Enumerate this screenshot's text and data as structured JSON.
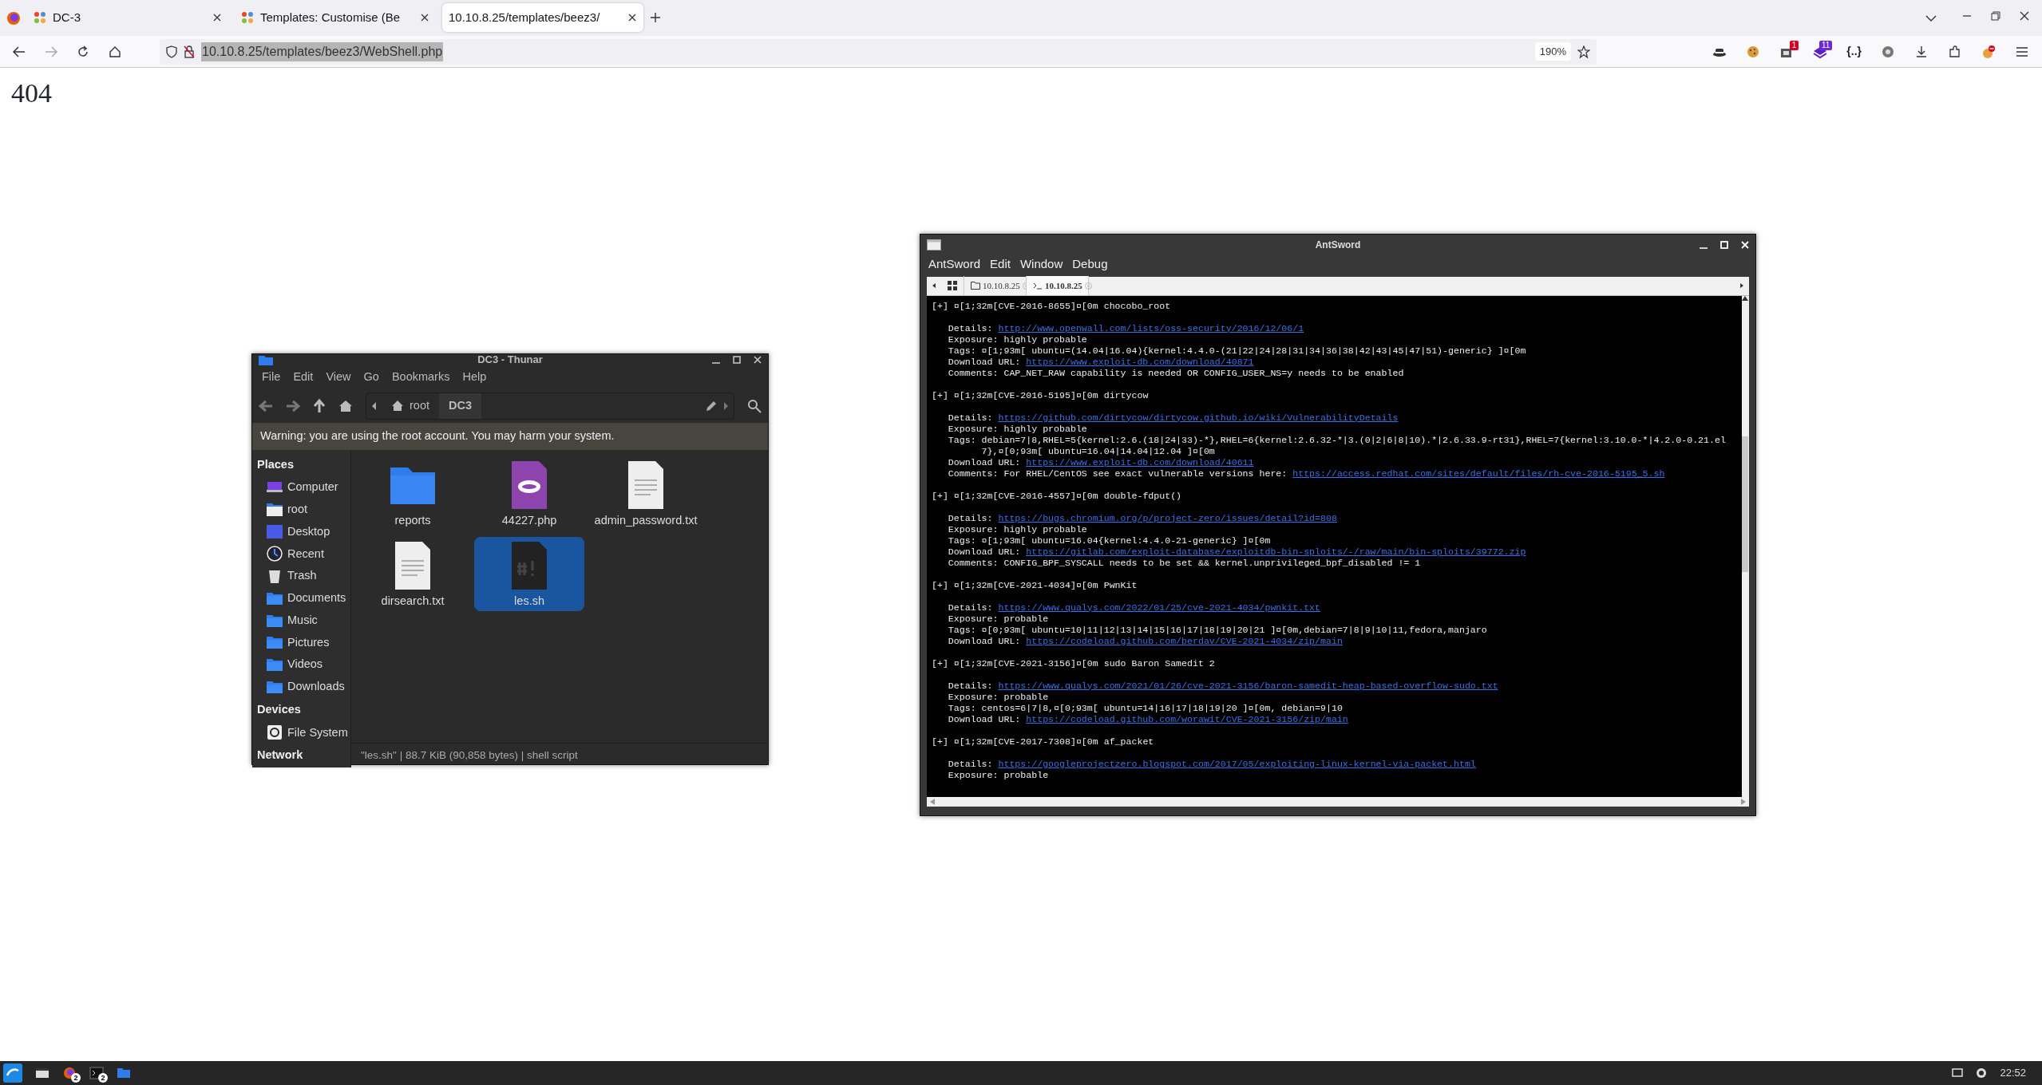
{
  "browser": {
    "tabs": [
      {
        "label": "DC-3",
        "kind": "joomla",
        "selected": false
      },
      {
        "label": "Templates: Customise (Be",
        "kind": "joomla",
        "selected": false
      },
      {
        "label": "10.10.8.25/templates/beez3/",
        "kind": "plain",
        "selected": true
      }
    ],
    "url": "10.10.8.25/templates/beez3/WebShell.php",
    "zoom": "190%",
    "extensions": [
      {
        "kind": "hat"
      },
      {
        "kind": "cookie"
      },
      {
        "kind": "mail",
        "badge": "1"
      },
      {
        "kind": "stack",
        "badge": "11"
      },
      {
        "kind": "braces",
        "label": "{..}"
      },
      {
        "kind": "gear"
      },
      {
        "kind": "download"
      },
      {
        "kind": "puzzle"
      },
      {
        "kind": "blocker"
      },
      {
        "kind": "menu"
      }
    ]
  },
  "page": {
    "heading": "404"
  },
  "thunar": {
    "title": "DC3 - Thunar",
    "menu": [
      "File",
      "Edit",
      "View",
      "Go",
      "Bookmarks",
      "Help"
    ],
    "path": [
      {
        "label": "root",
        "kind": "home",
        "selected": false
      },
      {
        "label": "DC3",
        "kind": "plain",
        "selected": true
      }
    ],
    "warning": "Warning: you are using the root account. You may harm your system.",
    "sidebar": [
      {
        "heading": "Places",
        "items": [
          {
            "label": "Computer",
            "kind": "computer"
          },
          {
            "label": "root",
            "kind": "home"
          },
          {
            "label": "Desktop",
            "kind": "desktop"
          },
          {
            "label": "Recent",
            "kind": "clock"
          },
          {
            "label": "Trash",
            "kind": "trash"
          },
          {
            "label": "Documents",
            "kind": "folder"
          },
          {
            "label": "Music",
            "kind": "folder"
          },
          {
            "label": "Pictures",
            "kind": "folder"
          },
          {
            "label": "Videos",
            "kind": "folder"
          },
          {
            "label": "Downloads",
            "kind": "folder"
          }
        ]
      },
      {
        "heading": "Devices",
        "items": [
          {
            "label": "File System",
            "kind": "drive"
          }
        ]
      },
      {
        "heading": "Network"
      }
    ],
    "files": [
      {
        "name": "reports",
        "kind": "folder",
        "selected": false
      },
      {
        "name": "44227.php",
        "kind": "php",
        "selected": false
      },
      {
        "name": "admin_password.txt",
        "kind": "text",
        "selected": false
      },
      {
        "name": "dirsearch.txt",
        "kind": "text",
        "selected": false
      },
      {
        "name": "les.sh",
        "kind": "script",
        "selected": true
      }
    ],
    "status": "\"les.sh\"  |  88.7 KiB (90,858 bytes)  |  shell script"
  },
  "antsword": {
    "title": "AntSword",
    "menu": [
      "AntSword",
      "Edit",
      "Window",
      "Debug"
    ],
    "tabs": [
      {
        "label": "10.10.8.25",
        "kind": "folder",
        "selected": false
      },
      {
        "label": "10.10.8.25",
        "kind": "terminal",
        "selected": true
      }
    ],
    "entries": [
      {
        "header": "[+] ¤[1;32m[CVE-2016-8655]¤[0m chocobo_root",
        "fields": [
          {
            "label": "Details:",
            "link": "http://www.openwall.com/lists/oss-security/2016/12/06/1"
          },
          {
            "label": "Exposure:",
            "value": "highly probable"
          },
          {
            "label": "Tags:",
            "value": "¤[1;93m[ ubuntu=(14.04|16.04){kernel:4.4.0-(21|22|24|28|31|34|36|38|42|43|45|47|51)-generic} ]¤[0m"
          },
          {
            "label": "Download URL:",
            "link": "https://www.exploit-db.com/download/40871"
          },
          {
            "label": "Comments:",
            "value": "CAP_NET_RAW capability is needed OR CONFIG_USER_NS=y needs to be enabled"
          }
        ]
      },
      {
        "header": "[+] ¤[1;32m[CVE-2016-5195]¤[0m dirtycow",
        "fields": [
          {
            "label": "Details:",
            "link": "https://github.com/dirtycow/dirtycow.github.io/wiki/VulnerabilityDetails"
          },
          {
            "label": "Exposure:",
            "value": "highly probable"
          },
          {
            "label": "Tags:",
            "value": "debian=7|8,RHEL=5{kernel:2.6.(18|24|33)-*},RHEL=6{kernel:2.6.32-*|3.(0|2|6|8|10).*|2.6.33.9-rt31},RHEL=7{kernel:3.10.0-*|4.2.0-0.21.el7},¤[0;93m[ ubuntu=16.04|14.04|12.04 ]¤[0m"
          },
          {
            "label": "Download URL:",
            "link": "https://www.exploit-db.com/download/40611"
          },
          {
            "label": "Comments:",
            "value": "For RHEL/CentOS see exact vulnerable versions here:",
            "link": "https://access.redhat.com/sites/default/files/rh-cve-2016-5195_5.sh"
          }
        ]
      },
      {
        "header": "[+] ¤[1;32m[CVE-2016-4557]¤[0m double-fdput()",
        "fields": [
          {
            "label": "Details:",
            "link": "https://bugs.chromium.org/p/project-zero/issues/detail?id=808"
          },
          {
            "label": "Exposure:",
            "value": "highly probable"
          },
          {
            "label": "Tags:",
            "value": "¤[1;93m[ ubuntu=16.04{kernel:4.4.0-21-generic} ]¤[0m"
          },
          {
            "label": "Download URL:",
            "link": "https://gitlab.com/exploit-database/exploitdb-bin-sploits/-/raw/main/bin-sploits/39772.zip"
          },
          {
            "label": "Comments:",
            "value": "CONFIG_BPF_SYSCALL needs to be set && kernel.unprivileged_bpf_disabled != 1"
          }
        ]
      },
      {
        "header": "[+] ¤[1;32m[CVE-2021-4034]¤[0m PwnKit",
        "fields": [
          {
            "label": "Details:",
            "link": "https://www.qualys.com/2022/01/25/cve-2021-4034/pwnkit.txt"
          },
          {
            "label": "Exposure:",
            "value": "probable"
          },
          {
            "label": "Tags:",
            "value": "¤[0;93m[ ubuntu=10|11|12|13|14|15|16|17|18|19|20|21 ]¤[0m,debian=7|8|9|10|11,fedora,manjaro"
          },
          {
            "label": "Download URL:",
            "link": "https://codeload.github.com/berdav/CVE-2021-4034/zip/main"
          }
        ]
      },
      {
        "header": "[+] ¤[1;32m[CVE-2021-3156]¤[0m sudo Baron Samedit 2",
        "fields": [
          {
            "label": "Details:",
            "link": "https://www.qualys.com/2021/01/26/cve-2021-3156/baron-samedit-heap-based-overflow-sudo.txt"
          },
          {
            "label": "Exposure:",
            "value": "probable"
          },
          {
            "label": "Tags:",
            "value": "centos=6|7|8,¤[0;93m[ ubuntu=14|16|17|18|19|20 ]¤[0m, debian=9|10"
          },
          {
            "label": "Download URL:",
            "link": "https://codeload.github.com/worawit/CVE-2021-3156/zip/main"
          }
        ]
      },
      {
        "header": "[+] ¤[1;32m[CVE-2017-7308]¤[0m af_packet",
        "fields": [
          {
            "label": "Details:",
            "link": "https://googleprojectzero.blogspot.com/2017/05/exploiting-linux-kernel-via-packet.html"
          },
          {
            "label": "Exposure:",
            "value": "probable"
          }
        ]
      }
    ]
  },
  "taskbar": {
    "items": [
      {
        "kind": "files"
      },
      {
        "kind": "firefox",
        "badge": "2"
      },
      {
        "kind": "terminal",
        "badge": "2"
      },
      {
        "kind": "folder"
      }
    ],
    "clock": "22:52"
  }
}
